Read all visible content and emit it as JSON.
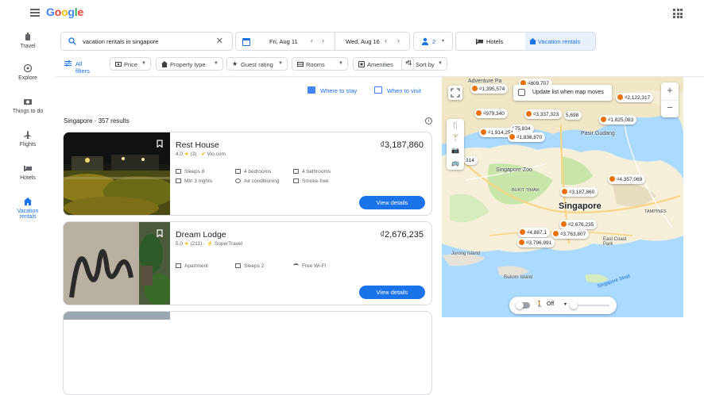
{
  "header": {
    "logo_letters": [
      "G",
      "o",
      "o",
      "g",
      "l",
      "e"
    ]
  },
  "nav": {
    "items": [
      {
        "label": "Travel",
        "icon": "travel-icon"
      },
      {
        "label": "Explore",
        "icon": "explore-icon"
      },
      {
        "label": "Things to do",
        "icon": "camera-icon"
      },
      {
        "label": "Flights",
        "icon": "flight-icon"
      },
      {
        "label": "Hotels",
        "icon": "bed-icon"
      },
      {
        "label": "Vacation rentals",
        "icon": "house-icon",
        "active": true
      }
    ]
  },
  "search": {
    "query": "vacation rentals in singapore"
  },
  "dates": {
    "check_in": "Fri, Aug 11",
    "check_out": "Wed, Aug 16"
  },
  "guests": {
    "count": "2"
  },
  "type_toggle": {
    "hotels": "Hotels",
    "vacation_rentals": "Vacation rentals"
  },
  "filters": {
    "all": "All filters",
    "price": "Price",
    "property_type": "Property type",
    "guest_rating": "Guest rating",
    "rooms": "Rooms",
    "amenities": "Amenities",
    "sort_by": "Sort by"
  },
  "results": {
    "where_to_stay": "Where to stay",
    "when_to_visit": "When to visit",
    "count_label": "Singapore · 357 results"
  },
  "listings": [
    {
      "name": "Rest House",
      "rating": "4.0",
      "reviews": "(3)",
      "source": "Vio.com",
      "price": "₫3,187,860",
      "amenities": [
        "Sleeps 8",
        "4 bedrooms",
        "4 bathrooms",
        "Min 3 nights",
        "Air conditioning",
        "Smoke-free"
      ],
      "button": "View details"
    },
    {
      "name": "Dream Lodge",
      "rating": "5.0",
      "reviews": "(211)",
      "source": "SuperTravel",
      "price": "₫2,676,235",
      "amenities": [
        "Apartment",
        "Sleeps 2",
        "Free Wi-Fi"
      ],
      "button": "View details"
    }
  ],
  "map": {
    "update_label": "Update list when map moves",
    "pins": [
      "₫809,707",
      "₫1,395,574",
      "₫2,122,317",
      "₫979,340",
      "₫3,337,323",
      "5,698",
      "₫1,825,083",
      "175,834",
      "₫1,914,251",
      "₫1,836,870",
      "314",
      "₫4,357,069",
      "₫3,187,860",
      "₫2,676,235",
      "₫4,887,1",
      "₫3,763,807",
      "₫3,796,991"
    ],
    "labels": {
      "city": "Singapore",
      "pasir_gudang": "Pasir Gudang",
      "zoo": "Singapore Zoo",
      "bukit_timah": "BUKIT TIMAH",
      "tampines": "TAMPINES",
      "east_coast": "East Coast Park",
      "jurong": "Jurong Island",
      "bukom": "Bukom Island",
      "strait": "Singapore Strait",
      "adventure": "Adventure Pa"
    },
    "time_toggle": "Off"
  }
}
